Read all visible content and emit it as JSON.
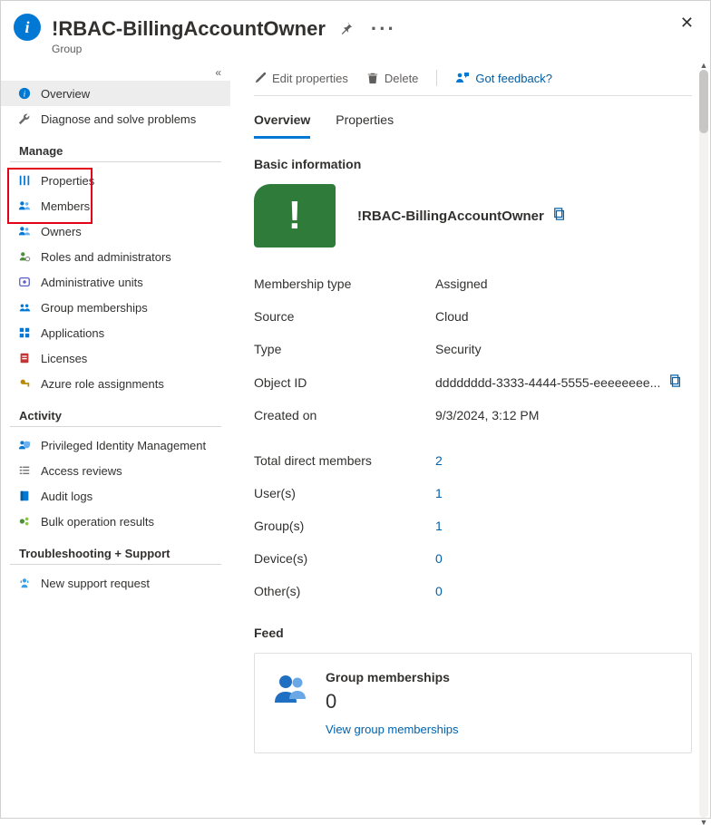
{
  "header": {
    "title": "!RBAC-BillingAccountOwner",
    "subtitle": "Group"
  },
  "toolbar": {
    "edit": "Edit properties",
    "delete": "Delete",
    "feedback": "Got feedback?"
  },
  "tabs": {
    "overview": "Overview",
    "properties": "Properties"
  },
  "sidebar": {
    "top": [
      {
        "icon": "info-icon",
        "label": "Overview",
        "active": true
      },
      {
        "icon": "wrench-icon",
        "label": "Diagnose and solve problems",
        "active": false
      }
    ],
    "sections": [
      {
        "title": "Manage",
        "items": [
          {
            "icon": "sliders-icon",
            "label": "Properties"
          },
          {
            "icon": "people-icon",
            "label": "Members"
          },
          {
            "icon": "people-icon",
            "label": "Owners"
          },
          {
            "icon": "person-gear-icon",
            "label": "Roles and administrators"
          },
          {
            "icon": "admin-unit-icon",
            "label": "Administrative units"
          },
          {
            "icon": "group-icon",
            "label": "Group memberships"
          },
          {
            "icon": "apps-icon",
            "label": "Applications"
          },
          {
            "icon": "license-icon",
            "label": "Licenses"
          },
          {
            "icon": "key-icon",
            "label": "Azure role assignments"
          }
        ]
      },
      {
        "title": "Activity",
        "items": [
          {
            "icon": "shield-people-icon",
            "label": "Privileged Identity Management"
          },
          {
            "icon": "checklist-icon",
            "label": "Access reviews"
          },
          {
            "icon": "book-icon",
            "label": "Audit logs"
          },
          {
            "icon": "bulk-icon",
            "label": "Bulk operation results"
          }
        ]
      },
      {
        "title": "Troubleshooting + Support",
        "items": [
          {
            "icon": "support-icon",
            "label": "New support request"
          }
        ]
      }
    ]
  },
  "basic": {
    "section_title": "Basic information",
    "group_name": "!RBAC-BillingAccountOwner",
    "tile_letter": "!",
    "fields": [
      {
        "key": "Membership type",
        "value": "Assigned"
      },
      {
        "key": "Source",
        "value": "Cloud"
      },
      {
        "key": "Type",
        "value": "Security"
      },
      {
        "key": "Object ID",
        "value": "dddddddd-3333-4444-5555-eeeeeeee...",
        "copy": true
      },
      {
        "key": "Created on",
        "value": "9/3/2024, 3:12 PM"
      }
    ],
    "members": [
      {
        "key": "Total direct members",
        "value": "2",
        "link": true
      },
      {
        "key": "User(s)",
        "value": "1",
        "link": true
      },
      {
        "key": "Group(s)",
        "value": "1",
        "link": true
      },
      {
        "key": "Device(s)",
        "value": "0",
        "link": true
      },
      {
        "key": "Other(s)",
        "value": "0",
        "link": true
      }
    ]
  },
  "feed": {
    "section_title": "Feed",
    "card": {
      "title": "Group memberships",
      "count": "0",
      "link": "View group memberships"
    }
  }
}
